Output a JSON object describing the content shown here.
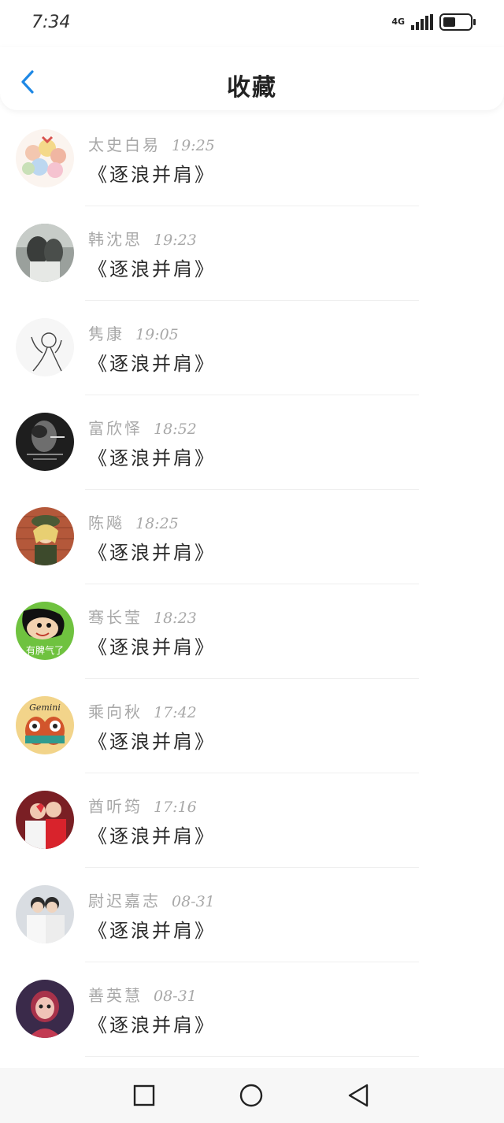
{
  "status_bar": {
    "time": "7:34",
    "network": "4G",
    "battery_level": 0.5
  },
  "header": {
    "title": "收藏",
    "back_icon": "chevron-left-icon",
    "accent_color": "#1e88e5"
  },
  "favorites": [
    {
      "name": "太史白易",
      "time": "19:25",
      "title": "《逐浪并肩》"
    },
    {
      "name": "韩沈思",
      "time": "19:23",
      "title": "《逐浪并肩》"
    },
    {
      "name": "隽康",
      "time": "19:05",
      "title": "《逐浪并肩》"
    },
    {
      "name": "富欣怿",
      "time": "18:52",
      "title": "《逐浪并肩》"
    },
    {
      "name": "陈飚",
      "time": "18:25",
      "title": "《逐浪并肩》"
    },
    {
      "name": "骞长莹",
      "time": "18:23",
      "title": "《逐浪并肩》"
    },
    {
      "name": "乘向秋",
      "time": "17:42",
      "title": "《逐浪并肩》"
    },
    {
      "name": "酋听筠",
      "time": "17:16",
      "title": "《逐浪并肩》"
    },
    {
      "name": "尉迟嘉志",
      "time": "08-31",
      "title": "《逐浪并肩》"
    },
    {
      "name": "善英慧",
      "time": "08-31",
      "title": "《逐浪并肩》"
    }
  ],
  "avatar_text": {
    "item_5": "有脾气了",
    "item_6": "Gemini"
  },
  "bottom_nav": {
    "recent_icon": "square-icon",
    "home_icon": "circle-icon",
    "back_icon": "triangle-back-icon"
  }
}
